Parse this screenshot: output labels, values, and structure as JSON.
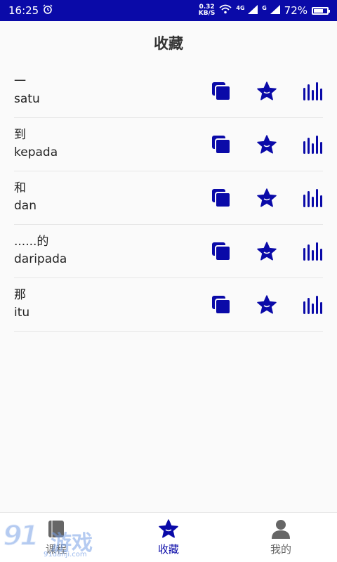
{
  "status_bar": {
    "time": "16:25",
    "net_speed_value": "0.32",
    "net_speed_unit": "KB/S",
    "signal_tag_1": "4G",
    "signal_tag_2": "G",
    "battery": "72%",
    "battery_level": 0.72
  },
  "header": {
    "title": "收藏"
  },
  "favorites": [
    {
      "zh": "一",
      "id": "satu"
    },
    {
      "zh": "到",
      "id": "kepada"
    },
    {
      "zh": "和",
      "id": "dan"
    },
    {
      "zh": "......的",
      "id": "daripada"
    },
    {
      "zh": "那",
      "id": "itu"
    }
  ],
  "colors": {
    "accent": "#0a0aa8",
    "inactive": "#666666"
  },
  "icons": {
    "copy": "copy-icon",
    "favorite": "star-icon",
    "audio": "audio-bars-icon"
  },
  "tabs": [
    {
      "key": "course",
      "label": "课程",
      "icon": "book-icon",
      "active": false
    },
    {
      "key": "favorites",
      "label": "收藏",
      "icon": "star-icon",
      "active": true
    },
    {
      "key": "mine",
      "label": "我的",
      "icon": "person-icon",
      "active": false
    }
  ],
  "watermark": {
    "big": "91",
    "cn": "游戏",
    "url": "91danji.com"
  }
}
